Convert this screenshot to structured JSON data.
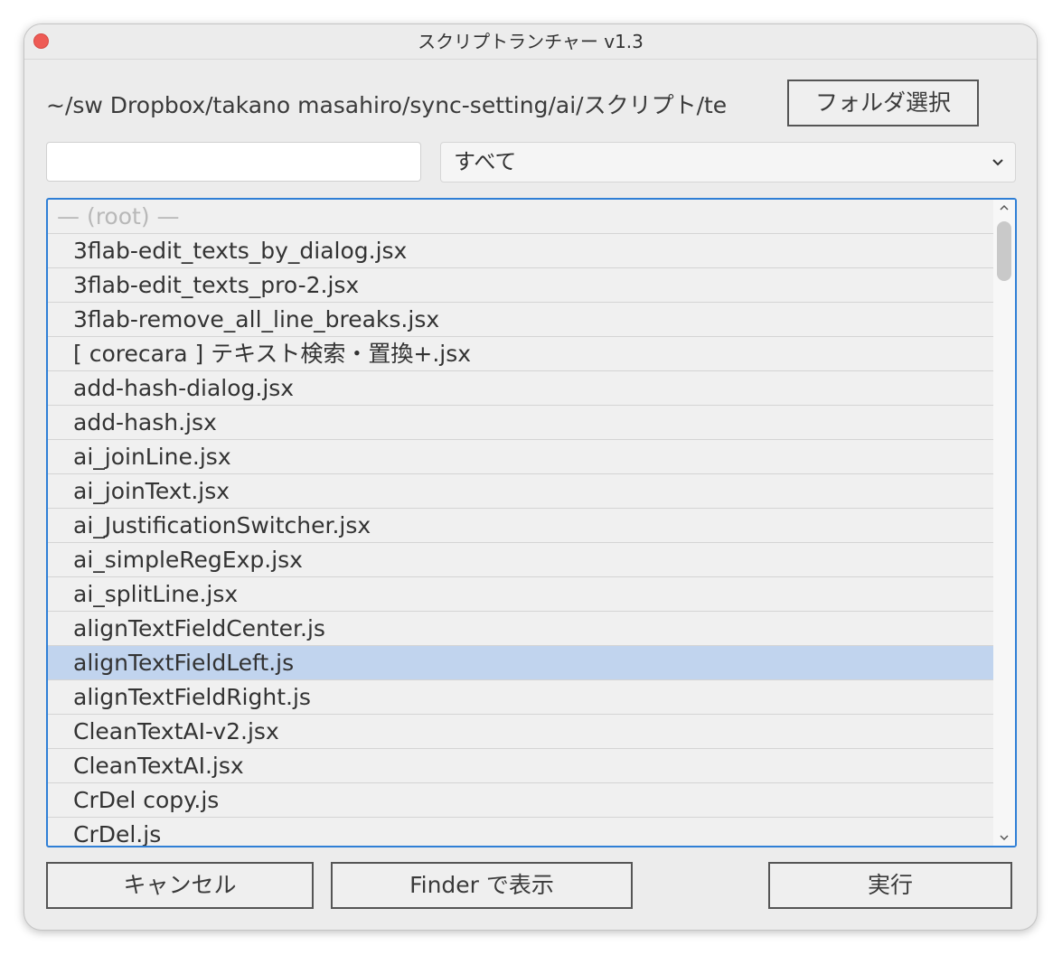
{
  "window": {
    "title": "スクリプトランチャー v1.3"
  },
  "header": {
    "path": "~/sw Dropbox/takano masahiro/sync-setting/ai/スクリプト/te",
    "folder_button": "フォルダ選択"
  },
  "filters": {
    "search_value": "",
    "category_selected": "すべて"
  },
  "list": {
    "root_label": "— (root) —",
    "items": [
      {
        "label": "3flab-edit_texts_by_dialog.jsx"
      },
      {
        "label": "3flab-edit_texts_pro-2.jsx"
      },
      {
        "label": "3flab-remove_all_line_breaks.jsx"
      },
      {
        "label": "[ corecara ] テキスト検索・置換+.jsx"
      },
      {
        "label": "add-hash-dialog.jsx"
      },
      {
        "label": "add-hash.jsx"
      },
      {
        "label": "ai_joinLine.jsx"
      },
      {
        "label": "ai_joinText.jsx"
      },
      {
        "label": "ai_JustificationSwitcher.jsx"
      },
      {
        "label": "ai_simpleRegExp.jsx"
      },
      {
        "label": "ai_splitLine.jsx"
      },
      {
        "label": "alignTextFieldCenter.js"
      },
      {
        "label": "alignTextFieldLeft.js",
        "selected": true
      },
      {
        "label": "alignTextFieldRight.js"
      },
      {
        "label": "CleanTextAI-v2.jsx"
      },
      {
        "label": "CleanTextAI.jsx"
      },
      {
        "label": "CrDel copy.js"
      },
      {
        "label": "CrDel.js"
      }
    ]
  },
  "footer": {
    "cancel_label": "キャンセル",
    "finder_label": "Finder で表示",
    "run_label": "実行"
  },
  "colors": {
    "accent": "#2f7fd6",
    "selection": "#c1d4ee",
    "close_button": "#ee5b55"
  }
}
